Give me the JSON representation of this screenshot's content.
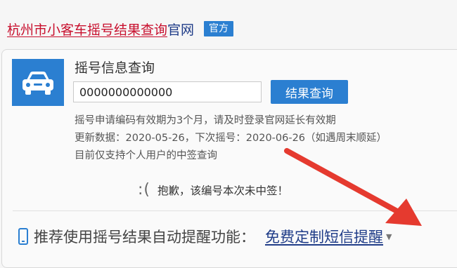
{
  "header": {
    "title_link": "杭州市小客车摇号结果查询",
    "title_suffix": "官网",
    "badge": "官方"
  },
  "card": {
    "heading": "摇号信息查询",
    "code_value": "0000000000000",
    "query_button": "结果查询",
    "notes": [
      "摇号申请编码有效期为3个月，请及时登录官网延长有效期",
      "更新数据：2020-05-26，下次摇号：2020-06-26（如遇周末顺延）",
      "目前仅支持个人用户的中签查询"
    ],
    "result_emoticon": ":(",
    "result_text": "抱歉，该编号本次未中签！"
  },
  "promo": {
    "text": "推荐使用摇号结果自动提醒功能：",
    "link": "免费定制短信提醒"
  },
  "colors": {
    "brand_red": "#c8102e",
    "primary_blue": "#2b7fd1",
    "link_navy": "#1f3c88",
    "arrow_red": "#e53a2f"
  }
}
